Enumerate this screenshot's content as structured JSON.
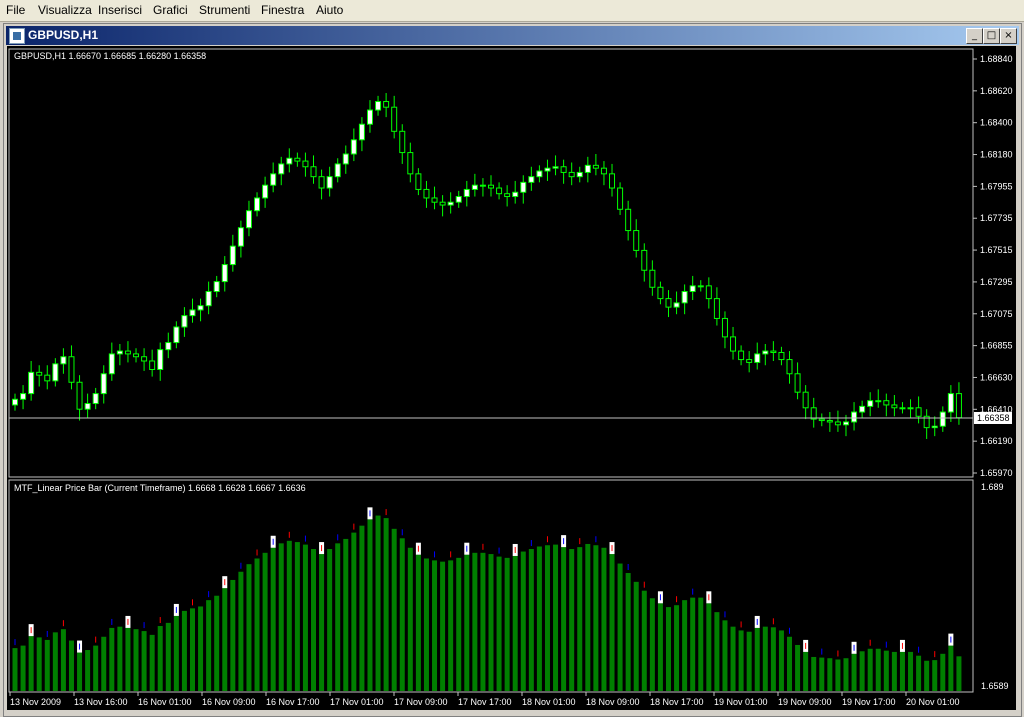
{
  "menu": [
    "File",
    "Visualizza",
    "Inserisci",
    "Grafici",
    "Strumenti",
    "Finestra",
    "Aiuto"
  ],
  "window": {
    "title": "GBPUSD,H1"
  },
  "colors": {
    "background": "#000000",
    "candle_up": "#ffffff",
    "candle_down": "#000000",
    "wick": "#00ff00",
    "volume_bar": "#008000",
    "volume_white": "#ffffff",
    "tick_red": "#ff0000",
    "tick_blue": "#0000ff",
    "price_line": "#c0c0c0",
    "grid": "#c0c0c0",
    "text": "#ffffff"
  },
  "main_panel": {
    "label": "GBPUSD,H1  1.66670 1.66685 1.66280 1.66358",
    "price_ticks": [
      "1.68840",
      "1.68620",
      "1.68400",
      "1.68180",
      "1.67955",
      "1.67735",
      "1.67515",
      "1.67295",
      "1.67075",
      "1.66855",
      "1.66630",
      "1.66410",
      "1.66190",
      "1.65970"
    ],
    "current_price": "1.66358"
  },
  "sub_panel": {
    "label": "MTF_Linear Price Bar (Current Timeframe) 1.6668 1.6628 1.6667 1.6636",
    "top_tick": "1.689",
    "bottom_tick": "1.6589"
  },
  "time_axis": [
    "13 Nov 2009",
    "13 Nov 16:00",
    "16 Nov 01:00",
    "16 Nov 09:00",
    "16 Nov 17:00",
    "17 Nov 01:00",
    "17 Nov 09:00",
    "17 Nov 17:00",
    "18 Nov 01:00",
    "18 Nov 09:00",
    "18 Nov 17:00",
    "19 Nov 01:00",
    "19 Nov 09:00",
    "19 Nov 17:00",
    "20 Nov 01:00"
  ],
  "chart_data": {
    "type": "candlestick",
    "symbol": "GBPUSD",
    "timeframe": "H1",
    "ylim": [
      1.6597,
      1.6889
    ],
    "close": [
      1.6649,
      1.6653,
      1.6668,
      1.6666,
      1.6662,
      1.6674,
      1.6679,
      1.6661,
      1.6642,
      1.6646,
      1.6653,
      1.6667,
      1.6681,
      1.6683,
      1.6681,
      1.6679,
      1.6676,
      1.667,
      1.6684,
      1.6689,
      1.67,
      1.6708,
      1.6712,
      1.6715,
      1.6725,
      1.6732,
      1.6744,
      1.6757,
      1.677,
      1.6782,
      1.6791,
      1.68,
      1.6808,
      1.6815,
      1.6819,
      1.6817,
      1.6813,
      1.6806,
      1.6798,
      1.6806,
      1.6815,
      1.6822,
      1.6832,
      1.6843,
      1.6853,
      1.6859,
      1.6855,
      1.6838,
      1.6823,
      1.6808,
      1.6797,
      1.6791,
      1.6788,
      1.6786,
      1.6788,
      1.6792,
      1.6797,
      1.68,
      1.68,
      1.6798,
      1.6794,
      1.6792,
      1.6795,
      1.6802,
      1.6806,
      1.681,
      1.6812,
      1.6813,
      1.6809,
      1.6806,
      1.6809,
      1.6814,
      1.6812,
      1.6808,
      1.6798,
      1.6783,
      1.6768,
      1.6754,
      1.674,
      1.6728,
      1.672,
      1.6714,
      1.6717,
      1.6725,
      1.6729,
      1.6729,
      1.672,
      1.6706,
      1.6693,
      1.6683,
      1.6677,
      1.6675,
      1.6681,
      1.6683,
      1.6682,
      1.6677,
      1.6667,
      1.6654,
      1.6643,
      1.6635,
      1.6634,
      1.6633,
      1.6631,
      1.6633,
      1.664,
      1.6644,
      1.6648,
      1.6648,
      1.6645,
      1.6643,
      1.6643,
      1.6643,
      1.6637,
      1.6629,
      1.663,
      1.664,
      1.6653,
      1.6636
    ]
  }
}
